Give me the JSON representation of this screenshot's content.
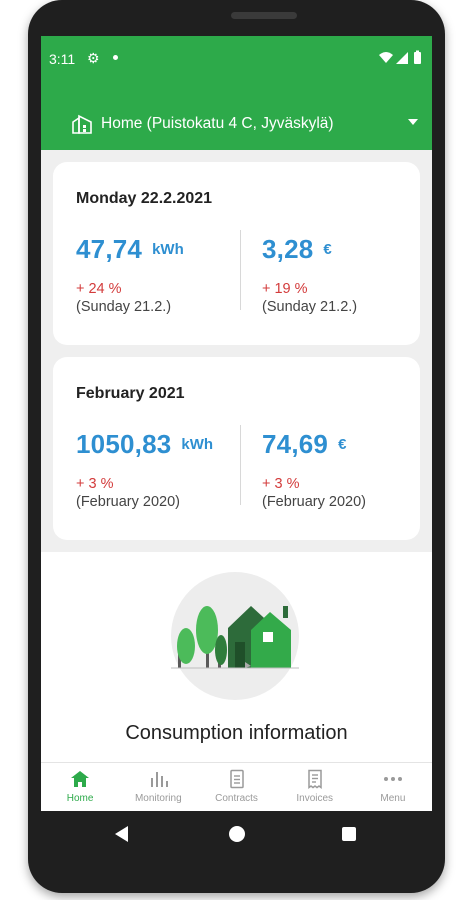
{
  "status": {
    "time": "3:11"
  },
  "location": {
    "label": "Home (Puistokatu 4 C, Jyväskylä)"
  },
  "daily": {
    "title": "Monday 22.2.2021",
    "energy": {
      "value": "47,74",
      "unit": "kWh",
      "change": "+ 24 %",
      "compare": "(Sunday 21.2.)"
    },
    "cost": {
      "value": "3,28",
      "unit": "€",
      "change": "+ 19 %",
      "compare": "(Sunday 21.2.)"
    }
  },
  "monthly": {
    "title": "February 2021",
    "energy": {
      "value": "1050,83",
      "unit": "kWh",
      "change": "+ 3 %",
      "compare": "(February 2020)"
    },
    "cost": {
      "value": "74,69",
      "unit": "€",
      "change": "+ 3 %",
      "compare": "(February 2020)"
    }
  },
  "info": {
    "title": "Consumption information"
  },
  "bottom_nav": [
    {
      "label": "Home",
      "icon": "home-icon",
      "active": true
    },
    {
      "label": "Monitoring",
      "icon": "bar-chart-icon",
      "active": false
    },
    {
      "label": "Contracts",
      "icon": "document-icon",
      "active": false
    },
    {
      "label": "Invoices",
      "icon": "invoice-icon",
      "active": false
    },
    {
      "label": "Menu",
      "icon": "more-icon",
      "active": false
    }
  ],
  "colors": {
    "brand_green": "#2daa4a",
    "value_blue": "#2e8fd1",
    "change_red": "#d33b3b"
  }
}
